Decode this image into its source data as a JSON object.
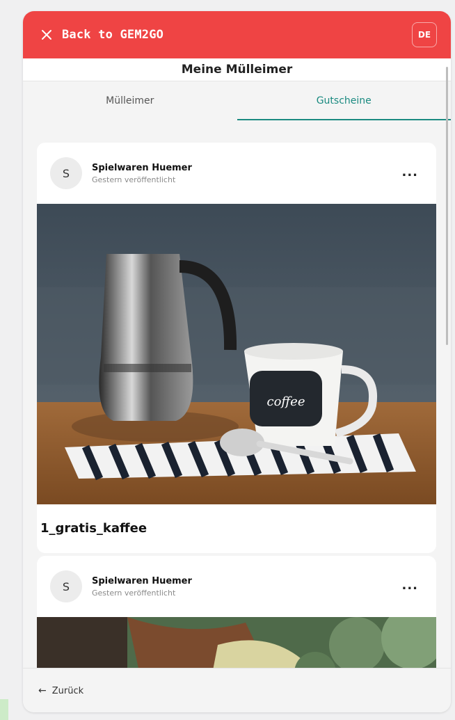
{
  "header": {
    "back_label": "Back to GEM2GO",
    "close_icon": "close-icon",
    "language": "DE",
    "brand_color": "#ef4444"
  },
  "page": {
    "title": "Meine Mülleimer"
  },
  "tabs": [
    {
      "label": "Mülleimer",
      "active": false
    },
    {
      "label": "Gutscheine",
      "active": true
    }
  ],
  "accent_color": "#1a8a80",
  "posts": [
    {
      "avatar": "S",
      "author": "Spielwaren Huemer",
      "meta": "Gestern veröffentlicht",
      "menu": "...",
      "image": "coffee-cup-photo",
      "title": "1_gratis_kaffee"
    },
    {
      "avatar": "S",
      "author": "Spielwaren Huemer",
      "meta": "Gestern veröffentlicht",
      "menu": "...",
      "image": "garden-photo"
    }
  ],
  "footer": {
    "back_label": "Zurück",
    "back_icon": "arrow-left-icon"
  }
}
